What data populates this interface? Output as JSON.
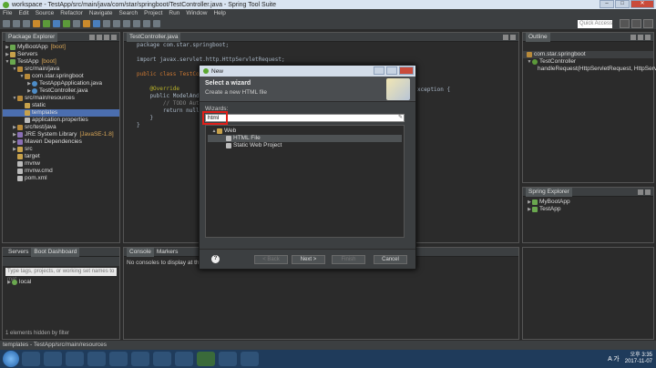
{
  "window": {
    "title": "workspace - TestApp/src/main/java/com/star/springboot/TestController.java - Spring Tool Suite"
  },
  "menu": [
    "File",
    "Edit",
    "Source",
    "Refactor",
    "Navigate",
    "Search",
    "Project",
    "Run",
    "Window",
    "Help"
  ],
  "quick_access": "Quick Access",
  "package_explorer": {
    "tab": "Package Explorer",
    "items": [
      {
        "label": "MyBootApp",
        "deco": "[boot]"
      },
      {
        "label": "Servers",
        "deco": ""
      },
      {
        "label": "TestApp",
        "deco": "[boot]"
      },
      {
        "label": "src/main/java",
        "deco": ""
      },
      {
        "label": "com.star.springboot",
        "deco": ""
      },
      {
        "label": "TestAppApplication.java",
        "deco": ""
      },
      {
        "label": "TestController.java",
        "deco": ""
      },
      {
        "label": "src/main/resources",
        "deco": ""
      },
      {
        "label": "static",
        "deco": ""
      },
      {
        "label": "templates",
        "deco": ""
      },
      {
        "label": "application.properties",
        "deco": ""
      },
      {
        "label": "src/test/java",
        "deco": ""
      },
      {
        "label": "JRE System Library",
        "deco": "[JavaSE-1.8]"
      },
      {
        "label": "Maven Dependencies",
        "deco": ""
      },
      {
        "label": "src",
        "deco": ""
      },
      {
        "label": "target",
        "deco": ""
      },
      {
        "label": "mvnw",
        "deco": ""
      },
      {
        "label": "mvnw.cmd",
        "deco": ""
      },
      {
        "label": "pom.xml",
        "deco": ""
      }
    ]
  },
  "editor": {
    "tab": "TestController.java",
    "lines": [
      "package com.star.springboot;",
      "",
      "import javax.servlet.http.HttpServletRequest;",
      "",
      "public class TestCont",
      "",
      "    @Override",
      "    public ModelAndVi",
      "        // TODO Auto-",
      "        return null;",
      "    }",
      "}"
    ],
    "right_fragment": "xception {"
  },
  "outline": {
    "tab": "Outline",
    "items": [
      "com.star.springboot",
      "TestController",
      "handleRequest(HttpServletRequest, HttpServ"
    ]
  },
  "spring_explorer": {
    "tab": "Spring Explorer",
    "items": [
      "MyBootApp",
      "TestApp"
    ]
  },
  "servers_panel": {
    "tabs": [
      "Servers",
      "Boot Dashboard"
    ],
    "search_placeholder": "Type tags, projects, or working set names to mat",
    "items": [
      "local"
    ],
    "hidden_note": "1 elements hidden by filter"
  },
  "console_panel": {
    "tabs": [
      "Console",
      "Markers"
    ],
    "message": "No consoles to display at this time."
  },
  "dialog": {
    "title": "New",
    "header_title": "Select a wizard",
    "header_desc": "Create a new HTML file",
    "wizards_label": "Wizards:",
    "filter_value": "html",
    "tree": [
      {
        "label": "Web",
        "level": 0
      },
      {
        "label": "HTML File",
        "level": 1
      },
      {
        "label": "Static Web Project",
        "level": 1
      }
    ],
    "buttons": {
      "help": "?",
      "back": "< Back",
      "next": "Next >",
      "finish": "Finish",
      "cancel": "Cancel"
    }
  },
  "status_bar": "templates - TestApp/src/main/resources",
  "taskbar": {
    "ime": "A 가",
    "time": "오후 3:35",
    "date": "2017-11-07"
  }
}
